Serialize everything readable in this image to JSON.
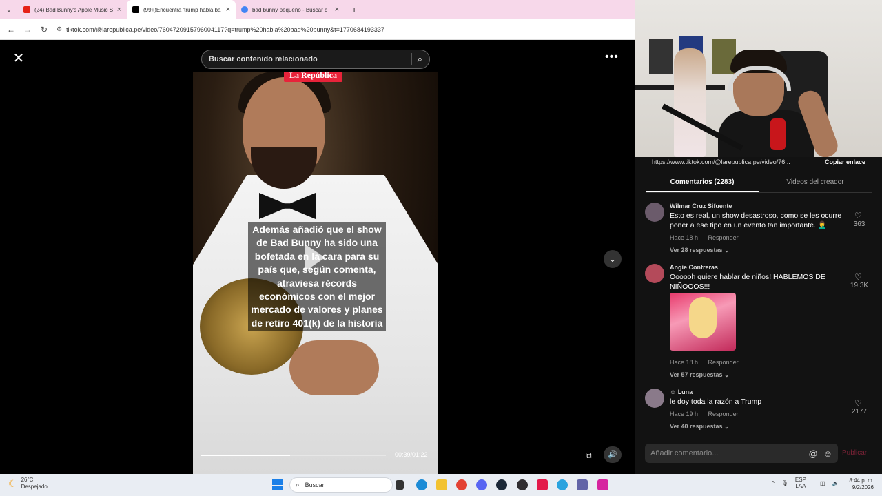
{
  "browser": {
    "tabs": [
      {
        "label": "(24) Bad Bunny's Apple Music S",
        "favicon_color": "#e62117",
        "active": false
      },
      {
        "label": "(99+)Encuentra 'trump habla ba",
        "favicon_color": "#000000",
        "active": true
      },
      {
        "label": "bad bunny pequeño - Buscar c",
        "favicon_color": "#4285f4",
        "active": false
      }
    ],
    "url": "tiktok.com/@larepublica.pe/video/7604720915796004117?q=trump%20habla%20bad%20bunny&t=1770684193337"
  },
  "video": {
    "search_placeholder": "Buscar contenido relacionado",
    "brand": "La República",
    "caption": "Además añadió que el show de Bad Bunny ha sido una bofetada en la cara para su país que, según comenta, atraviesa récords económicos con el mejor mercado de valores y planes de retiro 401(k) de la historia",
    "time": "00:39/01:22",
    "progress": 0.48
  },
  "panel": {
    "share_link": "https://www.tiktok.com/@larepublica.pe/video/76...",
    "copy_label": "Copiar enlace",
    "tabs": [
      "Comentarios (2283)",
      "Videos del creador"
    ],
    "comments": [
      {
        "name": "Wilmar Cruz Sifuente",
        "text": "Esto es real, un show desastroso, como se les ocurre poner a ese tipo en un evento tan importante. 🤦‍♂️",
        "time": "Hace 18 h",
        "reply": "Responder",
        "replies": "Ver 28 respuestas ⌄",
        "likes": "363"
      },
      {
        "name": "Angie Contreras",
        "text": "Oooooh quiere hablar de niños! HABLEMOS DE NIÑOOOS!!!",
        "time": "Hace 18 h",
        "reply": "Responder",
        "replies": "Ver 57 respuestas ⌄",
        "likes": "19.3K"
      },
      {
        "name": "☺ Luna",
        "text": "le doy toda la razón a Trump",
        "time": "Hace 19 h",
        "reply": "Responder",
        "replies": "Ver 40 respuestas ⌄",
        "likes": "2177"
      }
    ],
    "composer_placeholder": "Añadir comentario...",
    "publish_label": "Publicar"
  },
  "taskbar": {
    "temperature": "26°C",
    "weather": "Despejado",
    "search": "Buscar",
    "lang_top": "ESP",
    "lang_bottom": "LAA",
    "time": "8:44 p. m.",
    "date": "9/2/2026"
  },
  "icons": [
    "close-icon",
    "search-icon",
    "more-icon",
    "chevron-down-icon",
    "play-icon",
    "volume-icon",
    "heart-icon",
    "emoji-icon",
    "mention-icon"
  ]
}
